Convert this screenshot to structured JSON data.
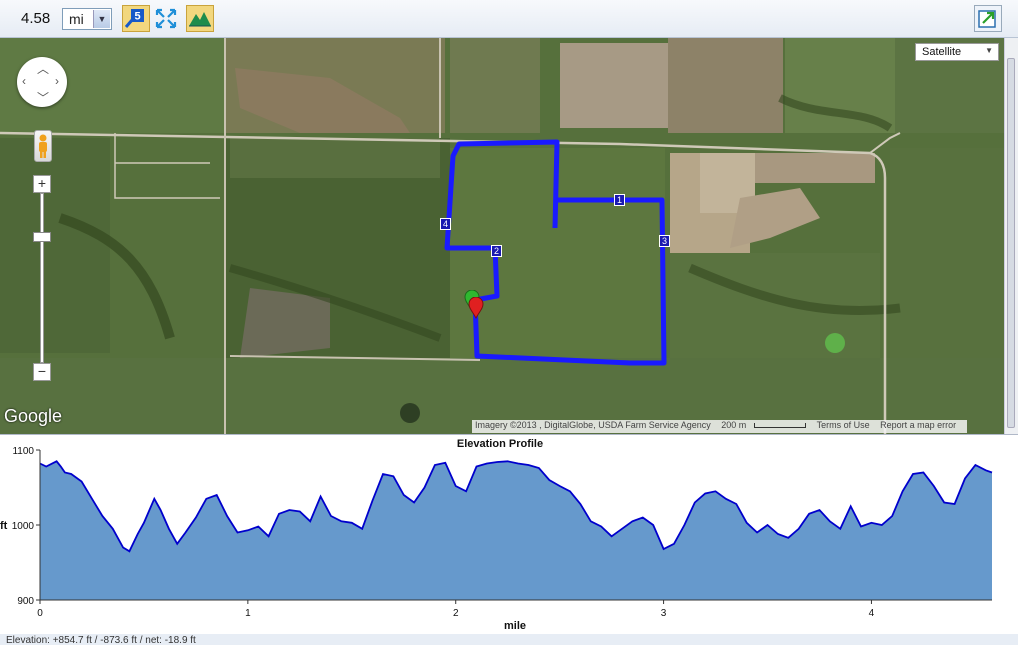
{
  "toolbar": {
    "distance_value": "4.58",
    "unit_selected": "mi",
    "buttons": [
      {
        "name": "laps-button",
        "badge": "5"
      },
      {
        "name": "fit-extent-button"
      },
      {
        "name": "elevation-button"
      },
      {
        "name": "export-button"
      }
    ]
  },
  "map": {
    "map_type": "Satellite",
    "google_logo": "Google",
    "attribution": "Imagery ©2013 , DigitalGlobe, USDA Farm Service Agency",
    "scale_label": "200 m",
    "terms": "Terms of Use",
    "report": "Report a map error",
    "mile_markers": [
      "1",
      "2",
      "3",
      "4"
    ],
    "route_color": "#1a1aff",
    "start_marker_color": "#2fb82f",
    "end_marker_color": "#e02020"
  },
  "chart_data": {
    "type": "area",
    "title": "Elevation Profile",
    "xlabel": "mile",
    "ylabel": "ft",
    "xlim": [
      0,
      4.58
    ],
    "ylim": [
      900,
      1100
    ],
    "x_ticks": [
      "0",
      "1",
      "2",
      "3",
      "4"
    ],
    "y_ticks": [
      "900",
      "1000",
      "1100"
    ],
    "fill_color": "#6699cc",
    "line_color": "#0000cc",
    "x": [
      0,
      0.03,
      0.08,
      0.1,
      0.12,
      0.15,
      0.2,
      0.25,
      0.3,
      0.35,
      0.4,
      0.43,
      0.47,
      0.5,
      0.55,
      0.58,
      0.62,
      0.66,
      0.7,
      0.75,
      0.8,
      0.85,
      0.9,
      0.95,
      1.0,
      1.05,
      1.1,
      1.15,
      1.2,
      1.25,
      1.3,
      1.35,
      1.4,
      1.45,
      1.5,
      1.55,
      1.6,
      1.65,
      1.7,
      1.75,
      1.8,
      1.85,
      1.9,
      1.95,
      2.0,
      2.05,
      2.1,
      2.15,
      2.2,
      2.25,
      2.3,
      2.35,
      2.4,
      2.45,
      2.5,
      2.55,
      2.6,
      2.65,
      2.7,
      2.75,
      2.8,
      2.85,
      2.9,
      2.95,
      3.0,
      3.05,
      3.1,
      3.15,
      3.2,
      3.25,
      3.3,
      3.35,
      3.4,
      3.45,
      3.5,
      3.55,
      3.6,
      3.65,
      3.7,
      3.75,
      3.8,
      3.85,
      3.9,
      3.95,
      4.0,
      4.05,
      4.1,
      4.15,
      4.2,
      4.25,
      4.3,
      4.35,
      4.4,
      4.45,
      4.5,
      4.55,
      4.58
    ],
    "values": [
      1082,
      1078,
      1085,
      1078,
      1070,
      1068,
      1058,
      1035,
      1012,
      995,
      970,
      965,
      988,
      1003,
      1035,
      1020,
      995,
      975,
      990,
      1010,
      1035,
      1040,
      1012,
      990,
      993,
      998,
      985,
      1015,
      1020,
      1018,
      1005,
      1038,
      1012,
      1005,
      1003,
      995,
      1033,
      1068,
      1065,
      1040,
      1030,
      1050,
      1080,
      1083,
      1052,
      1045,
      1078,
      1082,
      1084,
      1085,
      1082,
      1080,
      1076,
      1060,
      1052,
      1045,
      1028,
      1005,
      998,
      985,
      995,
      1005,
      1010,
      1000,
      968,
      975,
      1000,
      1030,
      1042,
      1045,
      1035,
      1028,
      1003,
      990,
      1000,
      988,
      983,
      995,
      1015,
      1020,
      1005,
      995,
      1025,
      998,
      1003,
      1000,
      1012,
      1045,
      1068,
      1070,
      1052,
      1030,
      1028,
      1062,
      1080,
      1073,
      1070
    ]
  },
  "status": {
    "text": "Elevation: +854.7 ft / -873.6 ft / net: -18.9 ft"
  }
}
